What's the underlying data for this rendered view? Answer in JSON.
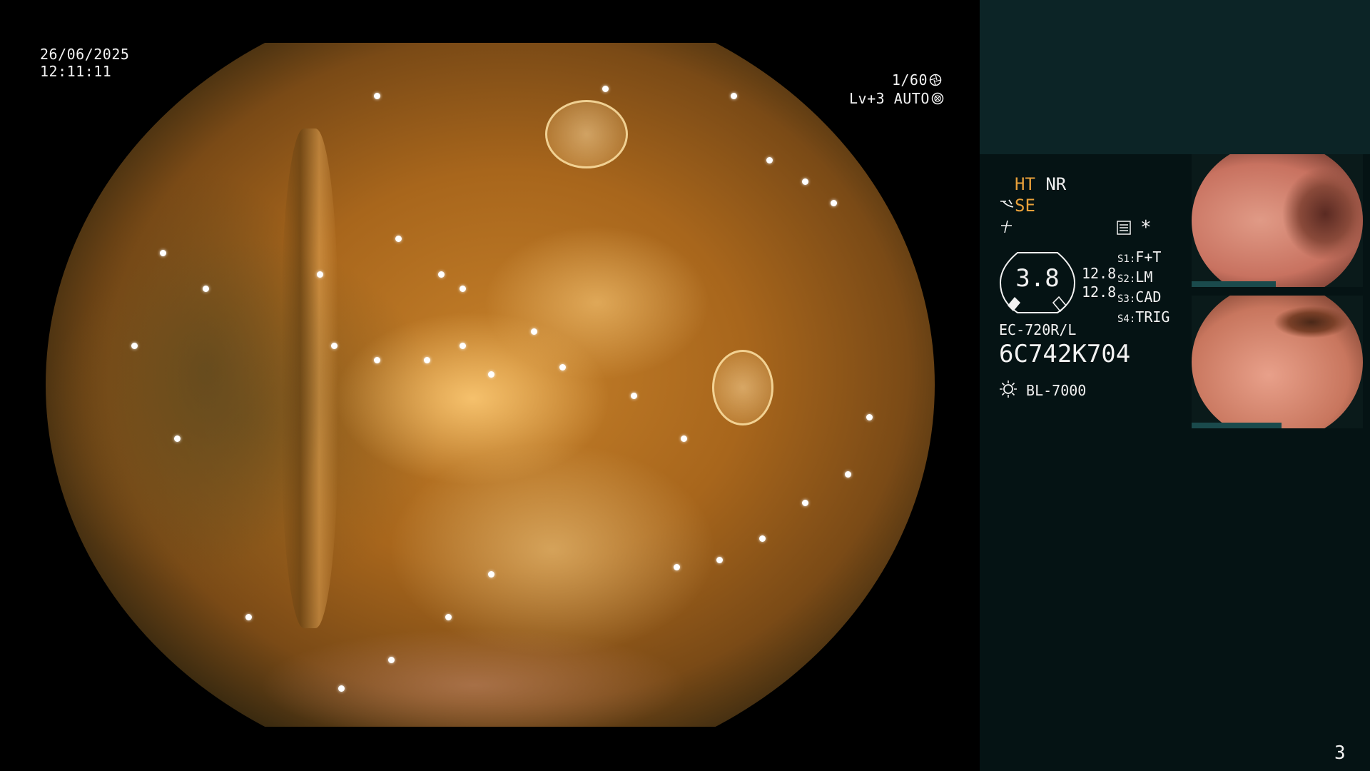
{
  "osd": {
    "date": "26/06/2025",
    "time": "12:11:11",
    "shutter": "1/60",
    "level": "Lv+3",
    "iris": "AUTO"
  },
  "panel": {
    "mode_ht": "HT",
    "mode_nr": "NR",
    "mode_se": "SE",
    "zoom_value": "3.8",
    "value_top": "12.8",
    "value_bottom": "12.8",
    "switches": [
      {
        "key": "S1",
        "value": "F+T"
      },
      {
        "key": "S2",
        "value": "LM"
      },
      {
        "key": "S3",
        "value": "CAD"
      },
      {
        "key": "S4",
        "value": "TRIG"
      }
    ],
    "scope_model": "EC-720R/L",
    "scope_serial": "6C742K704",
    "light_source": "BL-7000",
    "page_number": "3",
    "asterisk": "*"
  },
  "icons": {
    "shutter_icon": "aperture-icon",
    "iris_icon": "iris-icon",
    "settings_icon": "menu-list-icon",
    "light_icon": "lamp-icon"
  },
  "colors": {
    "accent_orange": "#e8a03a",
    "panel_bg": "#051314",
    "panel_top_bg": "#0c2426"
  }
}
